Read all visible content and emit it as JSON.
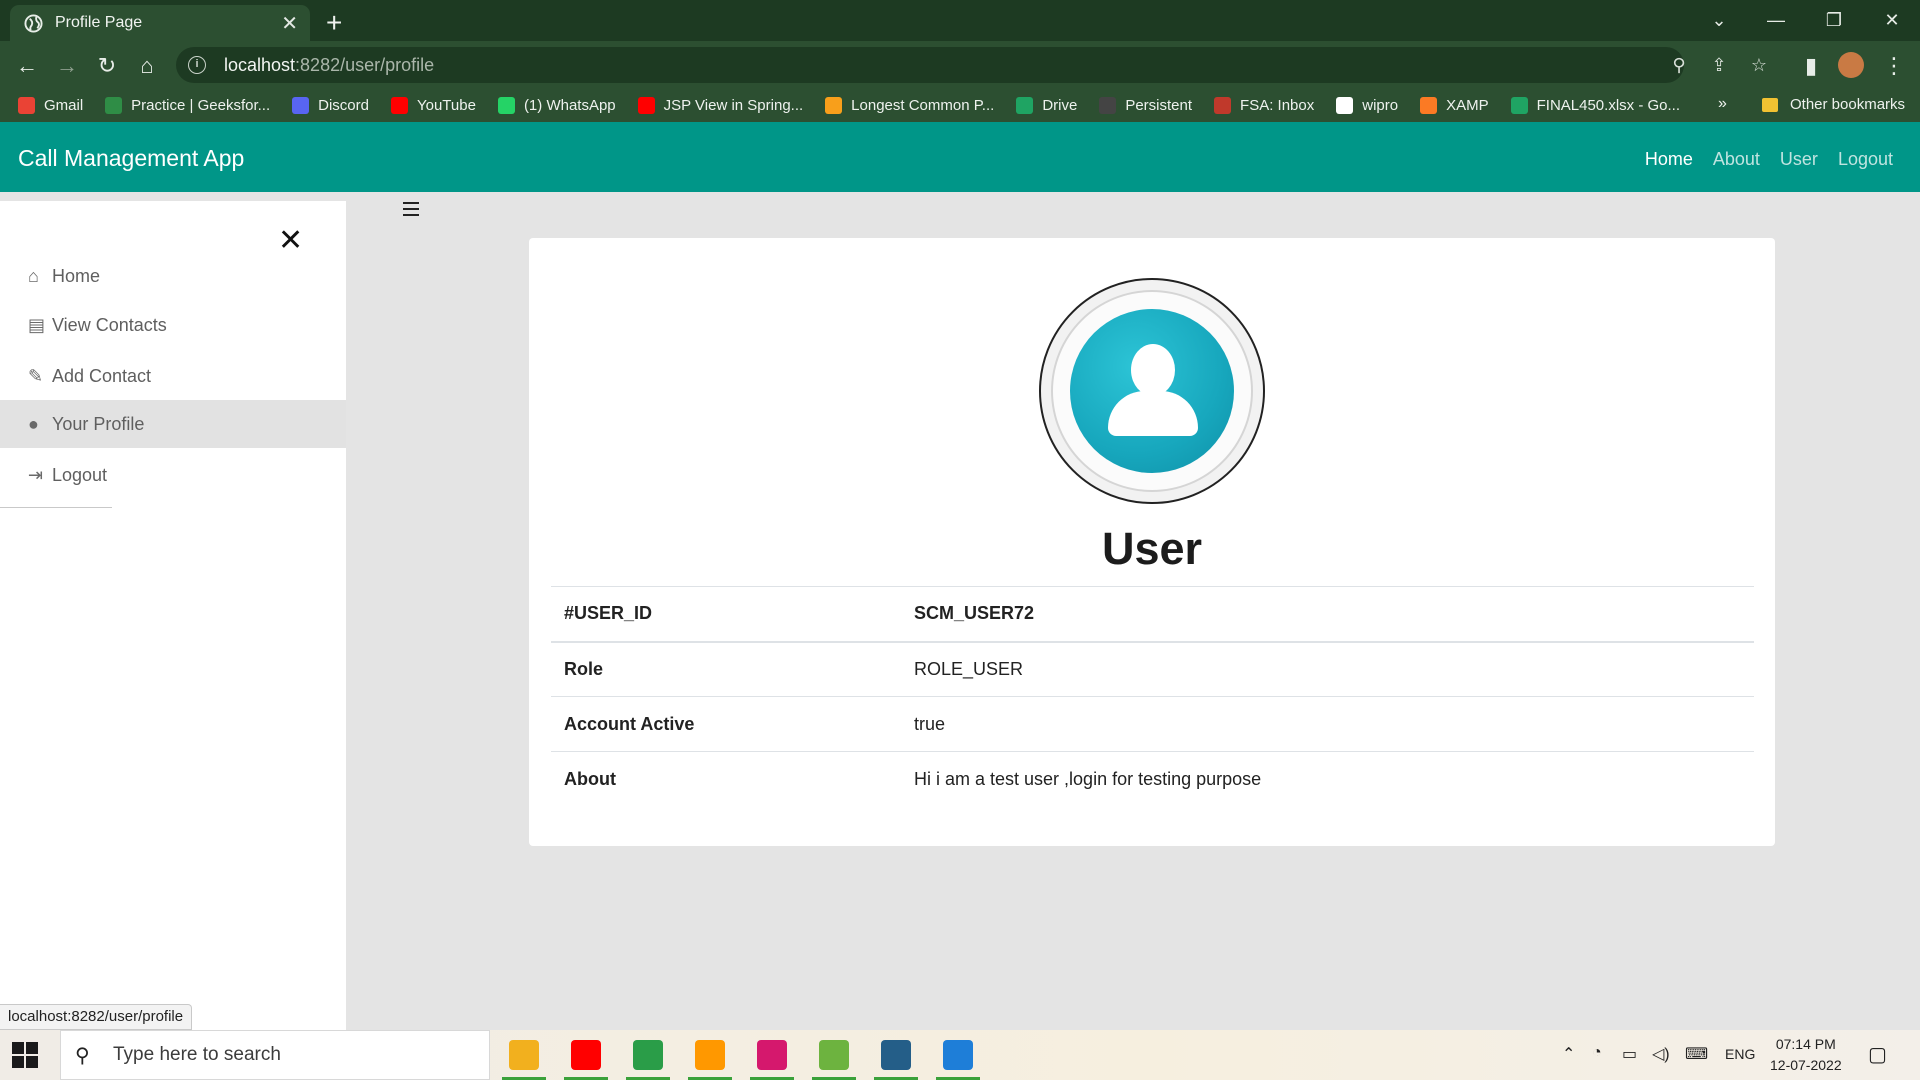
{
  "browser": {
    "tab_title": "Profile Page",
    "tab_close": "✕",
    "new_tab": "+",
    "url_host": "localhost",
    "url_path": ":8282/user/profile",
    "window_controls": [
      "⌄",
      "—",
      "❐",
      "✕"
    ],
    "bookmarks": [
      {
        "label": "Gmail",
        "color": "#ea4335"
      },
      {
        "label": "Practice | Geeksfor...",
        "color": "#2f8d46"
      },
      {
        "label": "Discord",
        "color": "#5865f2"
      },
      {
        "label": "YouTube",
        "color": "#ff0000"
      },
      {
        "label": "(1) WhatsApp",
        "color": "#25d366"
      },
      {
        "label": "JSP View in Spring...",
        "color": "#ff0000"
      },
      {
        "label": "Longest Common P...",
        "color": "#f89f1b"
      },
      {
        "label": "Drive",
        "color": "#1fa463"
      },
      {
        "label": "Persistent",
        "color": "#444444"
      },
      {
        "label": "FSA: Inbox",
        "color": "#c0392b"
      },
      {
        "label": "wipro",
        "color": "#ffffff"
      },
      {
        "label": "XAMP",
        "color": "#fb7a24"
      },
      {
        "label": "FINAL450.xlsx - Go...",
        "color": "#1fa463"
      }
    ],
    "bookmarks_more": "»",
    "other_bookmarks": "Other bookmarks"
  },
  "app": {
    "brand": "Call Management App",
    "nav": [
      "Home",
      "About",
      "User",
      "Logout"
    ],
    "sidebar": {
      "close": "✕",
      "items": [
        {
          "label": "Home",
          "icon": "home-icon",
          "glyph": "⌂"
        },
        {
          "label": "View Contacts",
          "icon": "contacts-icon",
          "glyph": "▤"
        },
        {
          "label": "Add Contact",
          "icon": "pencil-icon",
          "glyph": "✎"
        },
        {
          "label": "Your Profile",
          "icon": "user-circle-icon",
          "glyph": "●"
        },
        {
          "label": "Logout",
          "icon": "logout-icon",
          "glyph": "⇥"
        }
      ]
    },
    "profile": {
      "name": "User",
      "rows": [
        {
          "key": "#USER_ID",
          "value": "SCM_USER72"
        },
        {
          "key": "Role",
          "value": "ROLE_USER"
        },
        {
          "key": "Account Active",
          "value": "true"
        },
        {
          "key": "About",
          "value": "Hi i am a test user ,login for testing purpose"
        }
      ]
    },
    "status_url": "localhost:8282/user/profile"
  },
  "taskbar": {
    "search_placeholder": "Type here to search",
    "apps": [
      {
        "name": "file-explorer",
        "color": "#f2b01e"
      },
      {
        "name": "youtube",
        "color": "#ff0000"
      },
      {
        "name": "chrome",
        "color": "#2a9d48"
      },
      {
        "name": "sublime-text",
        "color": "#ff9800"
      },
      {
        "name": "intellij",
        "color": "#d5186d"
      },
      {
        "name": "spring-tool-suite",
        "color": "#6db33f"
      },
      {
        "name": "mysql-workbench",
        "color": "#245e88"
      },
      {
        "name": "photos",
        "color": "#1e7ed8"
      }
    ],
    "language": "ENG",
    "time": "07:14 PM",
    "date": "12-07-2022"
  },
  "colors": {
    "navbar": "#009688",
    "chrome_dark": "#1d3a22",
    "chrome": "#2c4f31"
  }
}
